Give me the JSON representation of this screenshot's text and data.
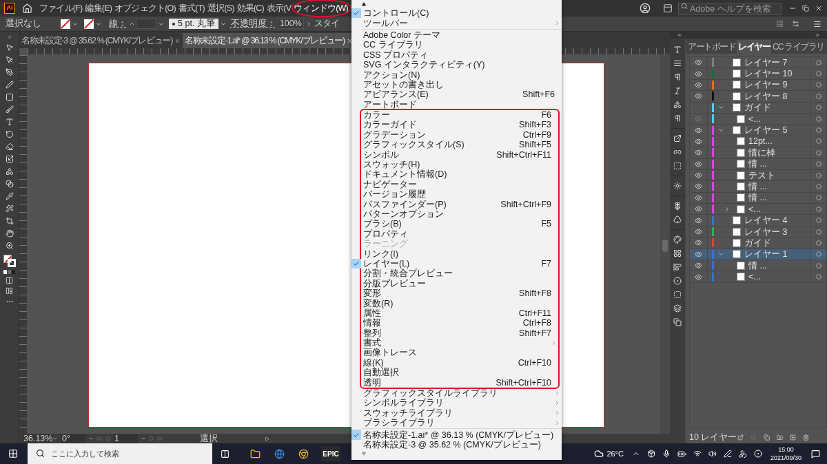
{
  "app": {
    "logo": "Ai"
  },
  "menubar": [
    {
      "label": "ファイル(F)",
      "open": false,
      "circled": false
    },
    {
      "label": "編集(E)",
      "open": false,
      "circled": false
    },
    {
      "label": "オブジェクト(O)",
      "open": false,
      "circled": false
    },
    {
      "label": "書式(T)",
      "open": false,
      "circled": false
    },
    {
      "label": "選択(S)",
      "open": false,
      "circled": false
    },
    {
      "label": "効果(C)",
      "open": false,
      "circled": false
    },
    {
      "label": "表示(V",
      "open": false,
      "circled": false
    },
    {
      "label": "ウィンドウ(W)",
      "open": true,
      "circled": true
    }
  ],
  "help_search": {
    "placeholder": "Adobe ヘルプを検索"
  },
  "control_bar": {
    "selection": "選択なし",
    "stroke_label": "線：",
    "brush": "5 pt. 丸筆",
    "opacity_label": "不透明度：",
    "opacity": "100%",
    "style_label": "スタイ"
  },
  "doc_tabs": [
    {
      "title": "名称未設定-3 @ 35.62 % (CMYK/プレビュー)",
      "selected": false
    },
    {
      "title": "名称未設定-1.ai* @ 36.13 % (CMYK/プレビュー)",
      "selected": true
    }
  ],
  "status_bar": {
    "zoom": "36.13%",
    "rotation": "0°",
    "artboard": "1",
    "tool": "選択"
  },
  "panel": {
    "tabs": [
      {
        "label": "アートボード",
        "selected": false
      },
      {
        "label": "レイヤー",
        "selected": true
      },
      {
        "label": "CC ライブラリ",
        "selected": false
      }
    ],
    "layers": [
      {
        "name": "レイヤー 7",
        "color": "#808080",
        "visible": true,
        "selected": false
      },
      {
        "name": "レイヤー 10",
        "color": "#1d6b3c",
        "visible": true,
        "selected": false
      },
      {
        "name": "レイヤー 9",
        "color": "#f26522",
        "visible": true,
        "selected": false
      },
      {
        "name": "レイヤー 8",
        "color": "#111111",
        "visible": true,
        "selected": false
      },
      {
        "name": "ガイド",
        "color": "#4fd1ee",
        "visible": false,
        "expanded": true,
        "selected": false,
        "children": [
          {
            "name": "<...",
            "color": "#4fd1ee",
            "visible": true,
            "selected": false
          }
        ]
      },
      {
        "name": "レイヤー 5",
        "color": "#e040e0",
        "visible": true,
        "expanded": true,
        "selected": false,
        "children": [
          {
            "name": "12pt...",
            "color": "#e040e0",
            "visible": true,
            "selected": false
          },
          {
            "name": "情に棹",
            "color": "#e040e0",
            "visible": true,
            "selected": false
          },
          {
            "name": "情 ...",
            "color": "#e040e0",
            "visible": true,
            "selected": false
          },
          {
            "name": "テスト",
            "color": "#e040e0",
            "visible": true,
            "selected": false
          },
          {
            "name": "情 ...",
            "color": "#e040e0",
            "visible": true,
            "selected": false
          },
          {
            "name": "情 ...",
            "color": "#e040e0",
            "visible": true,
            "selected": false
          },
          {
            "name": "<...",
            "color": "#e040e0",
            "visible": true,
            "expanded": false,
            "selected": false
          }
        ]
      },
      {
        "name": "レイヤー 4",
        "color": "#3b6fd9",
        "visible": true,
        "selected": false
      },
      {
        "name": "レイヤー 3",
        "color": "#3aa85a",
        "visible": true,
        "selected": false
      },
      {
        "name": "ガイド",
        "color": "#e23c3c",
        "visible": true,
        "selected": false
      },
      {
        "name": "レイヤー 1",
        "color": "#3b6fd9",
        "visible": true,
        "expanded": true,
        "selected": true,
        "children": [
          {
            "name": "情 ...",
            "color": "#3b6fd9",
            "visible": true,
            "selected": false
          },
          {
            "name": "<...",
            "color": "#3b6fd9",
            "visible": true,
            "selected": false
          }
        ]
      }
    ],
    "footer": "10 レイヤー"
  },
  "window_menu": {
    "sections": [
      {
        "outlined": false,
        "items": [
          {
            "label": "コントロール(C)",
            "checked": true,
            "disabled": false,
            "submenu": false
          },
          {
            "label": "ツールバー",
            "checked": false,
            "disabled": false,
            "submenu": true
          }
        ]
      },
      {
        "outlined": false,
        "items": [
          {
            "label": "Adobe Color テーマ",
            "checked": false,
            "disabled": false,
            "submenu": false
          },
          {
            "label": "CC ライブラリ",
            "checked": false,
            "disabled": false,
            "submenu": false
          },
          {
            "label": "CSS プロパティ",
            "checked": false,
            "disabled": false,
            "submenu": false
          },
          {
            "label": "SVG インタラクティビティ(Y)",
            "checked": false,
            "disabled": false,
            "submenu": false
          },
          {
            "label": "アクション(N)",
            "checked": false,
            "disabled": false,
            "submenu": false
          },
          {
            "label": "アセットの書き出し",
            "checked": false,
            "disabled": false,
            "submenu": false
          },
          {
            "label": "アピアランス(E)",
            "shortcut": "Shift+F6",
            "checked": false,
            "disabled": false,
            "submenu": false
          },
          {
            "label": "アートボード",
            "checked": false,
            "disabled": false,
            "submenu": false
          }
        ]
      },
      {
        "outlined": true,
        "items": [
          {
            "label": "カラー",
            "shortcut": "F6",
            "checked": false,
            "disabled": false,
            "submenu": false
          },
          {
            "label": "カラーガイド",
            "shortcut": "Shift+F3",
            "checked": false,
            "disabled": false,
            "submenu": false
          },
          {
            "label": "グラデーション",
            "shortcut": "Ctrl+F9",
            "checked": false,
            "disabled": false,
            "submenu": false
          },
          {
            "label": "グラフィックスタイル(S)",
            "shortcut": "Shift+F5",
            "checked": false,
            "disabled": false,
            "submenu": false
          },
          {
            "label": "シンボル",
            "shortcut": "Shift+Ctrl+F11",
            "checked": false,
            "disabled": false,
            "submenu": false
          },
          {
            "label": "スウォッチ(H)",
            "checked": false,
            "disabled": false,
            "submenu": false
          },
          {
            "label": "ドキュメント情報(D)",
            "checked": false,
            "disabled": false,
            "submenu": false
          },
          {
            "label": "ナビゲーター",
            "checked": false,
            "disabled": false,
            "submenu": false
          },
          {
            "label": "バージョン履歴",
            "checked": false,
            "disabled": false,
            "submenu": false
          },
          {
            "label": "パスファインダー(P)",
            "shortcut": "Shift+Ctrl+F9",
            "checked": false,
            "disabled": false,
            "submenu": false
          },
          {
            "label": "パターンオプション",
            "checked": false,
            "disabled": false,
            "submenu": false
          },
          {
            "label": "ブラシ(B)",
            "shortcut": "F5",
            "checked": false,
            "disabled": false,
            "submenu": false
          },
          {
            "label": "プロパティ",
            "checked": false,
            "disabled": false,
            "submenu": false
          },
          {
            "label": "ラーニング",
            "checked": false,
            "disabled": true,
            "submenu": false
          },
          {
            "label": "リンク(I)",
            "checked": false,
            "disabled": false,
            "submenu": false
          },
          {
            "label": "レイヤー(L)",
            "shortcut": "F7",
            "checked": true,
            "disabled": false,
            "submenu": false
          },
          {
            "label": "分割・統合プレビュー",
            "checked": false,
            "disabled": false,
            "submenu": false
          },
          {
            "label": "分版プレビュー",
            "checked": false,
            "disabled": false,
            "submenu": false
          },
          {
            "label": "変形",
            "shortcut": "Shift+F8",
            "checked": false,
            "disabled": false,
            "submenu": false
          },
          {
            "label": "変数(R)",
            "checked": false,
            "disabled": false,
            "submenu": false
          },
          {
            "label": "属性",
            "shortcut": "Ctrl+F11",
            "checked": false,
            "disabled": false,
            "submenu": false
          },
          {
            "label": "情報",
            "shortcut": "Ctrl+F8",
            "checked": false,
            "disabled": false,
            "submenu": false
          },
          {
            "label": "整列",
            "shortcut": "Shift+F7",
            "checked": false,
            "disabled": false,
            "submenu": false
          },
          {
            "label": "書式",
            "checked": false,
            "disabled": false,
            "submenu": true
          },
          {
            "label": "画像トレース",
            "checked": false,
            "disabled": false,
            "submenu": false
          },
          {
            "label": "線(K)",
            "shortcut": "Ctrl+F10",
            "checked": false,
            "disabled": false,
            "submenu": false
          },
          {
            "label": "自動選択",
            "checked": false,
            "disabled": false,
            "submenu": false
          },
          {
            "label": "透明",
            "shortcut": "Shift+Ctrl+F10",
            "checked": false,
            "disabled": false,
            "submenu": false
          }
        ]
      },
      {
        "outlined": false,
        "items": [
          {
            "label": "グラフィックスタイルライブラリ",
            "checked": false,
            "disabled": false,
            "submenu": true
          },
          {
            "label": "シンボルライブラリ",
            "checked": false,
            "disabled": false,
            "submenu": true
          },
          {
            "label": "スウォッチライブラリ",
            "checked": false,
            "disabled": false,
            "submenu": true
          },
          {
            "label": "ブラシライブラリ",
            "checked": false,
            "disabled": false,
            "submenu": true
          }
        ]
      },
      {
        "outlined": false,
        "items": [
          {
            "label": "名称未設定-1.ai* @ 36.13 % (CMYK/プレビュー)",
            "checked": true,
            "disabled": false,
            "submenu": false
          },
          {
            "label": "名称未設定-3 @ 35.62 % (CMYK/プレビュー)",
            "checked": false,
            "disabled": false,
            "submenu": false
          }
        ]
      }
    ]
  },
  "taskbar": {
    "search_placeholder": "ここに入力して検索",
    "game_app": "EPIC",
    "weather": "26°C",
    "ime": "あ",
    "time": "15:00",
    "date": "2021/09/30"
  }
}
